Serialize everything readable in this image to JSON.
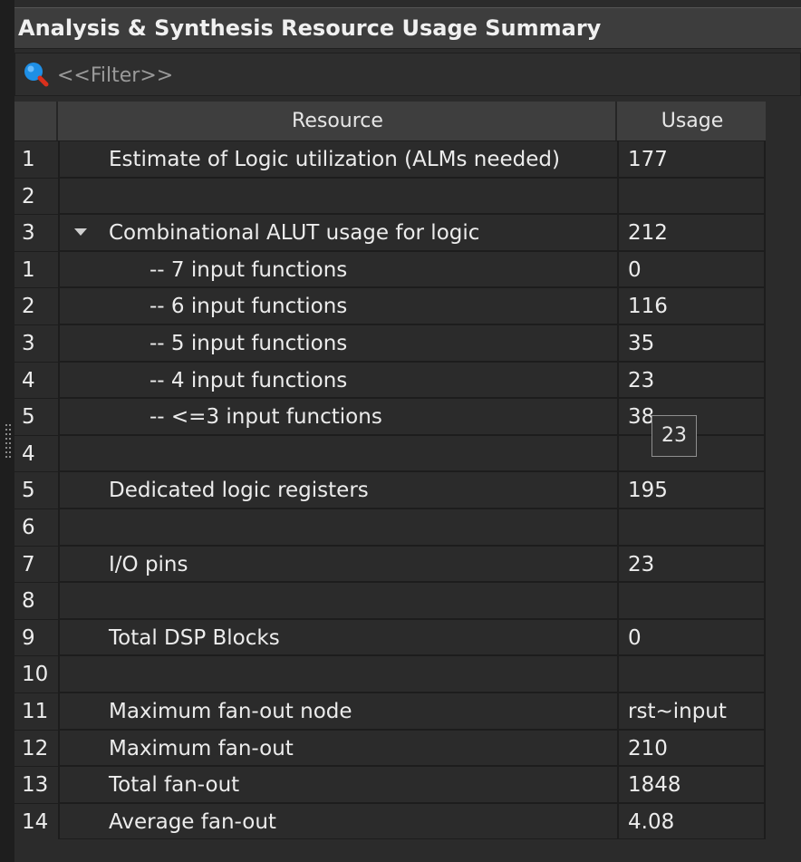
{
  "panel": {
    "title": "Analysis & Synthesis Resource Usage Summary"
  },
  "filter": {
    "placeholder": "<<Filter>>",
    "value": ""
  },
  "table": {
    "columns": [
      "Resource",
      "Usage"
    ],
    "rows": [
      {
        "num": "1",
        "resource": "Estimate of Logic utilization (ALMs needed)",
        "usage": "177",
        "level": 1
      },
      {
        "num": "2",
        "resource": "",
        "usage": "",
        "level": 1
      },
      {
        "num": "3",
        "resource": "Combinational ALUT usage for logic",
        "usage": "212",
        "level": 1,
        "expandable": true
      },
      {
        "num": "1",
        "resource": "-- 7 input functions",
        "usage": "0",
        "level": 2
      },
      {
        "num": "2",
        "resource": "-- 6 input functions",
        "usage": "116",
        "level": 2
      },
      {
        "num": "3",
        "resource": "-- 5 input functions",
        "usage": "35",
        "level": 2
      },
      {
        "num": "4",
        "resource": "-- 4 input functions",
        "usage": "23",
        "level": 2
      },
      {
        "num": "5",
        "resource": "-- <=3 input functions",
        "usage": "38",
        "level": 2
      },
      {
        "num": "4",
        "resource": "",
        "usage": "",
        "level": 1
      },
      {
        "num": "5",
        "resource": "Dedicated logic registers",
        "usage": "195",
        "level": 1
      },
      {
        "num": "6",
        "resource": "",
        "usage": "",
        "level": 1
      },
      {
        "num": "7",
        "resource": "I/O pins",
        "usage": "23",
        "level": 1
      },
      {
        "num": "8",
        "resource": "",
        "usage": "",
        "level": 1
      },
      {
        "num": "9",
        "resource": "Total DSP Blocks",
        "usage": "0",
        "level": 1
      },
      {
        "num": "10",
        "resource": "",
        "usage": "",
        "level": 1
      },
      {
        "num": "11",
        "resource": "Maximum fan-out node",
        "usage": "rst~input",
        "level": 1
      },
      {
        "num": "12",
        "resource": "Maximum fan-out",
        "usage": "210",
        "level": 1
      },
      {
        "num": "13",
        "resource": "Total fan-out",
        "usage": "1848",
        "level": 1
      },
      {
        "num": "14",
        "resource": "Average fan-out",
        "usage": "4.08",
        "level": 1
      }
    ]
  },
  "tooltip": {
    "text": "23"
  },
  "icons": {
    "filter": "magnifier-icon",
    "expander": "triangle-down-icon"
  },
  "colors": {
    "background": "#2b2b2b",
    "header": "#3e3e3e",
    "grid_line": "#1d1d1d",
    "text": "#ececec",
    "icon_blue": "#1e8fe6",
    "icon_red": "#d9301c"
  }
}
